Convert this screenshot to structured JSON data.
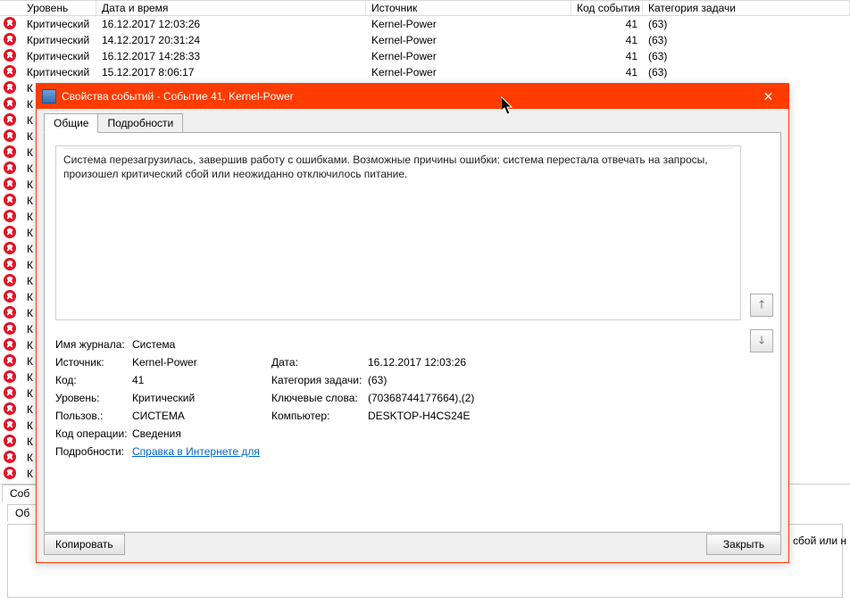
{
  "table": {
    "headers": {
      "level": "Уровень",
      "date": "Дата и время",
      "source": "Источник",
      "event_id": "Код события",
      "category": "Категория задачи"
    },
    "rows": [
      {
        "level": "Критический",
        "date": "16.12.2017 12:03:26",
        "source": "Kernel-Power",
        "event_id": "41",
        "category": "(63)"
      },
      {
        "level": "Критический",
        "date": "14.12.2017 20:31:24",
        "source": "Kernel-Power",
        "event_id": "41",
        "category": "(63)"
      },
      {
        "level": "Критический",
        "date": "16.12.2017 14:28:33",
        "source": "Kernel-Power",
        "event_id": "41",
        "category": "(63)"
      },
      {
        "level": "Критический",
        "date": "15.12.2017 8:06:17",
        "source": "Kernel-Power",
        "event_id": "41",
        "category": "(63)"
      },
      {
        "level": "К",
        "date": "",
        "source": "",
        "event_id": "",
        "category": ""
      },
      {
        "level": "К",
        "date": "",
        "source": "",
        "event_id": "",
        "category": ""
      },
      {
        "level": "К",
        "date": "",
        "source": "",
        "event_id": "",
        "category": ""
      },
      {
        "level": "К",
        "date": "",
        "source": "",
        "event_id": "",
        "category": ""
      },
      {
        "level": "К",
        "date": "",
        "source": "",
        "event_id": "",
        "category": ""
      },
      {
        "level": "К",
        "date": "",
        "source": "",
        "event_id": "",
        "category": ""
      },
      {
        "level": "К",
        "date": "",
        "source": "",
        "event_id": "",
        "category": ""
      },
      {
        "level": "К",
        "date": "",
        "source": "",
        "event_id": "",
        "category": ""
      },
      {
        "level": "К",
        "date": "",
        "source": "",
        "event_id": "",
        "category": ""
      },
      {
        "level": "К",
        "date": "",
        "source": "",
        "event_id": "",
        "category": ""
      },
      {
        "level": "К",
        "date": "",
        "source": "",
        "event_id": "",
        "category": ""
      },
      {
        "level": "К",
        "date": "",
        "source": "",
        "event_id": "",
        "category": ""
      },
      {
        "level": "К",
        "date": "",
        "source": "",
        "event_id": "",
        "category": ""
      },
      {
        "level": "К",
        "date": "",
        "source": "",
        "event_id": "",
        "category": ""
      },
      {
        "level": "К",
        "date": "",
        "source": "",
        "event_id": "",
        "category": ""
      },
      {
        "level": "К",
        "date": "",
        "source": "",
        "event_id": "",
        "category": ""
      },
      {
        "level": "К",
        "date": "",
        "source": "",
        "event_id": "",
        "category": ""
      },
      {
        "level": "К",
        "date": "",
        "source": "",
        "event_id": "",
        "category": ""
      },
      {
        "level": "К",
        "date": "",
        "source": "",
        "event_id": "",
        "category": ""
      },
      {
        "level": "К",
        "date": "",
        "source": "",
        "event_id": "",
        "category": ""
      },
      {
        "level": "К",
        "date": "",
        "source": "",
        "event_id": "",
        "category": ""
      },
      {
        "level": "К",
        "date": "",
        "source": "",
        "event_id": "",
        "category": ""
      },
      {
        "level": "К",
        "date": "",
        "source": "",
        "event_id": "",
        "category": ""
      },
      {
        "level": "К",
        "date": "",
        "source": "",
        "event_id": "",
        "category": ""
      },
      {
        "level": "К",
        "date": "",
        "source": "",
        "event_id": "",
        "category": ""
      }
    ]
  },
  "bottom": {
    "tab1": "Соб",
    "tab2": "Об",
    "fragment": "й сбой или н"
  },
  "dialog": {
    "title": "Свойства событий - Событие 41, Kernel-Power",
    "tabs": {
      "general": "Общие",
      "details": "Подробности"
    },
    "message": "Система перезагрузилась, завершив работу с ошибками. Возможные причины ошибки: система перестала отвечать на запросы, произошел критический сбой или неожиданно отключилось питание.",
    "fields": {
      "log_label": "Имя журнала:",
      "log_value": "Система",
      "source_label": "Источник:",
      "source_value": "Kernel-Power",
      "date_label": "Дата:",
      "date_value": "16.12.2017 12:03:26",
      "code_label": "Код:",
      "code_value": "41",
      "cat_label": "Категория задачи:",
      "cat_value": "(63)",
      "level_label": "Уровень:",
      "level_value": "Критический",
      "keywords_label": "Ключевые слова:",
      "keywords_value": "(70368744177664),(2)",
      "user_label": "Пользов.:",
      "user_value": "СИСТЕМА",
      "computer_label": "Компьютер:",
      "computer_value": "DESKTOP-H4CS24E",
      "opcode_label": "Код операции:",
      "opcode_value": "Сведения",
      "details_label": "Подробности:",
      "details_link": "Справка в Интернете для "
    },
    "buttons": {
      "copy": "Копировать",
      "close": "Закрыть"
    },
    "nav": {
      "up": "▲",
      "down": "▼"
    }
  }
}
